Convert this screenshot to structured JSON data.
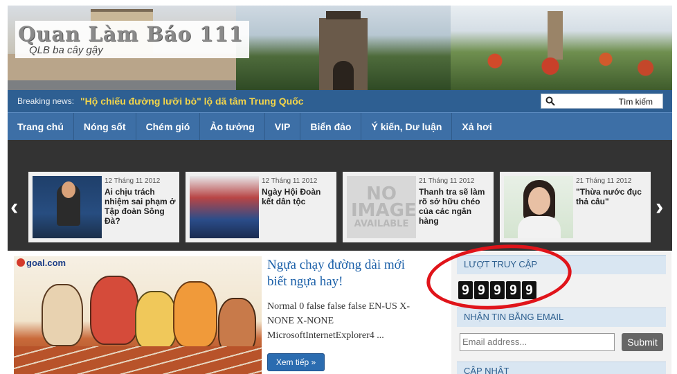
{
  "header": {
    "logo_title": "Quan Làm Báo 111",
    "logo_subtitle": "QLB ba cây gậy"
  },
  "breaking": {
    "label": "Breaking news:",
    "headline": "\"Hộ chiếu đường lưỡi bò\" lộ dã tâm Trung Quốc",
    "search_button": "Tìm kiếm"
  },
  "nav": {
    "items": [
      "Trang chủ",
      "Nóng sốt",
      "Chém gió",
      "Ảo tưởng",
      "VIP",
      "Biển đảo",
      "Ý kiến, Dư luận",
      "Xả hơi"
    ]
  },
  "carousel": {
    "prev": "‹",
    "next": "›",
    "cards": [
      {
        "date": "12 Tháng 11 2012",
        "title": "Ai chịu trách nhiệm sai phạm ở Tập đoàn Sông Đà?"
      },
      {
        "date": "12 Tháng 11 2012",
        "title": "Ngày Hội Đoàn kết dân tộc"
      },
      {
        "date": "21 Tháng 11 2012",
        "title": "Thanh tra sẽ làm rõ sở hữu chéo của các ngân hàng",
        "no_image": "NO IMAGE",
        "no_image_sub": "AVAILABLE"
      },
      {
        "date": "21 Tháng 11 2012",
        "title": "\"Thừa nước đục thả câu\""
      }
    ]
  },
  "article": {
    "source_logo": "goal.com",
    "title": "Ngựa chạy đường dài mới biết ngựa hay!",
    "excerpt": "Normal 0 false false false EN-US X-NONE X-NONE MicrosoftInternetExplorer4 ...",
    "more_label": "Xem tiếp »"
  },
  "sidebar": {
    "visits_title": "LƯỢT TRUY CẬP",
    "counter_digits": [
      "9",
      "9",
      "9",
      "9",
      "9"
    ],
    "email_title": "NHẬN TIN BẰNG EMAIL",
    "email_placeholder": "Email address...",
    "submit_label": "Submit",
    "update_title": "CẬP NHẬT"
  },
  "colors": {
    "nav_bg": "#3d6fa6",
    "breaking_bg": "#2e5f92",
    "breaking_text": "#f3d54a",
    "highlight_circle": "#e0141a"
  }
}
